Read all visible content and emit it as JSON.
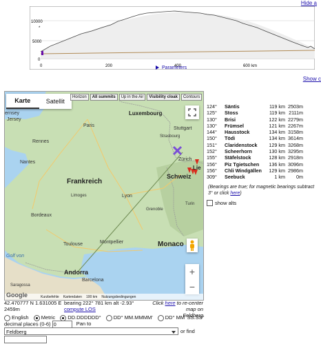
{
  "header": {
    "hide_link": "Hide a",
    "parameters_label": "Parameters",
    "show_link": "Show c"
  },
  "profile": {
    "y_ticks": [
      "10000",
      "5000",
      "0"
    ],
    "x_ticks": [
      "0",
      "200",
      "400",
      "600"
    ],
    "x_unit": "km",
    "marker_label": "*"
  },
  "map": {
    "tabs": [
      "Karte",
      "Satellit"
    ],
    "buttons": [
      "Horizon",
      "All summits",
      "Up in the Air",
      "Visibility cloak",
      "Contours"
    ],
    "labels": {
      "jersey": "Jersey",
      "guernsey": "ernsey",
      "luxembourg": "Luxembourg",
      "stuttgart": "Stuttgart",
      "paris": "Paris",
      "strasbourg": "Strasbourg",
      "rennes": "Rennes",
      "nantes": "Nantes",
      "frankreich": "Frankreich",
      "zurich": "Zürich",
      "lie": "Lie",
      "schweiz": "Schweiz",
      "lyon": "Lyon",
      "bordeaux": "Bordeaux",
      "toulouse": "Toulouse",
      "montpellier": "Montpellier",
      "monaco": "Monaco",
      "andorra": "Andorra",
      "barcelona": "Barcelona",
      "saragossa": "Saragossa",
      "golf": "Golf von",
      "limoges": "Limoges",
      "grenoble": "Grenoble",
      "turin": "Turin"
    },
    "google": "Google",
    "attribution": [
      "Kurzbefehle",
      "Kartendaten",
      "100 km",
      "Nutzungsbedingungen"
    ]
  },
  "summits": [
    {
      "az": "124°",
      "name": "Säntis",
      "dist": "119 km",
      "elev": "2503m"
    },
    {
      "az": "125°",
      "name": "Stoss",
      "dist": "119 km",
      "elev": "2111m"
    },
    {
      "az": "130°",
      "name": "Brisi",
      "dist": "122 km",
      "elev": "2279m"
    },
    {
      "az": "130°",
      "name": "Frümsel",
      "dist": "121 km",
      "elev": "2267m"
    },
    {
      "az": "144°",
      "name": "Hausstock",
      "dist": "134 km",
      "elev": "3158m"
    },
    {
      "az": "150°",
      "name": "Tödi",
      "dist": "134 km",
      "elev": "3614m"
    },
    {
      "az": "151°",
      "name": "Claridenstock",
      "dist": "129 km",
      "elev": "3268m"
    },
    {
      "az": "152°",
      "name": "Scheerhorn",
      "dist": "130 km",
      "elev": "3295m"
    },
    {
      "az": "155°",
      "name": "Stäfelstock",
      "dist": "128 km",
      "elev": "2918m"
    },
    {
      "az": "156°",
      "name": "Piz Tgietschen",
      "dist": "136 km",
      "elev": "3096m"
    },
    {
      "az": "156°",
      "name": "Chli Windgällen",
      "dist": "129 km",
      "elev": "2986m"
    },
    {
      "az": "309°",
      "name": "Seebuck",
      "dist": "1 km",
      "elev": "0m"
    }
  ],
  "summit_note_pre": "(Bearings are true; for magnetic bearings subtract 3° or click ",
  "summit_note_link": "here",
  "summit_note_post": ")",
  "show_alts": "show alts",
  "info": {
    "coords": "42.470777 N 1.631005 E",
    "elev": "2459m",
    "bearing": "bearing 222° 781 km alt -2.93°",
    "compute_los": "compute LOS",
    "recenter_pre": "Click ",
    "recenter_link": "here",
    "recenter_post": " to re-center map on",
    "recenter_place": "Feldberg",
    "unit_english": "English",
    "unit_metric": "Metric",
    "fmt1": "DD.DDDDDD°",
    "fmt2": "DD° MM.MMMM'",
    "fmt3": "DD° MM' SS.SS\"",
    "decimal_label": "decimal places (0-6)",
    "decimal_value": "0",
    "pan_to": "Pan to",
    "select_value": "Feldberg",
    "or_find": "or find"
  }
}
